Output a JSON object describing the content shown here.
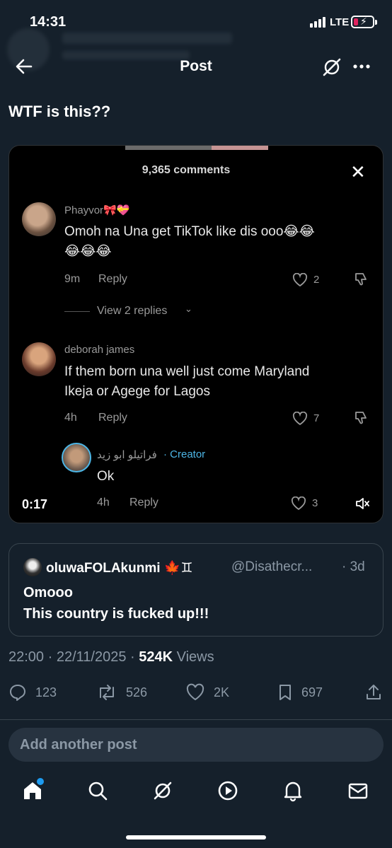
{
  "status_bar": {
    "time": "14:31",
    "network": "LTE"
  },
  "header": {
    "title": "Post"
  },
  "post": {
    "text": "WTF is this??"
  },
  "media": {
    "comments_count": "9,365 comments",
    "video_time": "0:17",
    "comments": [
      {
        "name": "Phayvor🎀💝",
        "text_line1": "Omoh na Una get TikTok like dis ooo😂😂",
        "text_line2": "😂😂😂",
        "time": "9m",
        "reply": "Reply",
        "likes": "2",
        "view_replies": "View 2 replies"
      },
      {
        "name": "deborah james",
        "text_line1": "If them born una well just come Maryland",
        "text_line2": "Ikeja or Agege for Lagos",
        "time": "4h",
        "reply": "Reply",
        "likes": "7"
      },
      {
        "name": "فراتيلو ابو زيد",
        "creator": "· Creator",
        "text": "Ok",
        "time": "4h",
        "reply": "Reply",
        "likes": "3"
      }
    ]
  },
  "quote": {
    "name": "oluwaFOLAkunmi 🍁♊",
    "handle": "@Disathecr...",
    "age": "· 3d",
    "line1": "Omooo",
    "line2": "This country is fucked up!!!"
  },
  "meta": {
    "time": "22:00",
    "date": "22/11/2025",
    "views_count": "524K",
    "views_label": "Views"
  },
  "actions": {
    "replies": "123",
    "reposts": "526",
    "likes": "2K",
    "bookmarks": "697"
  },
  "reply_box": {
    "placeholder": "Add another post"
  },
  "colors": {
    "background": "#15202b",
    "accent": "#1d9bf0",
    "muted": "#8b98a5"
  }
}
